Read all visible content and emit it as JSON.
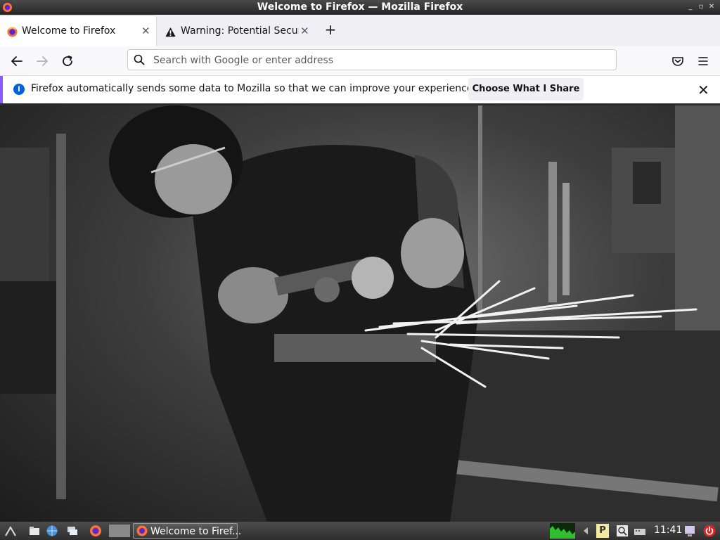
{
  "window": {
    "title": "Welcome to Firefox — Mozilla Firefox"
  },
  "tabs": [
    {
      "label": "Welcome to Firefox",
      "active": true,
      "icon": "firefox-icon"
    },
    {
      "label": "Warning: Potential Security Risk Ahead",
      "active": false,
      "icon": "warning-icon"
    }
  ],
  "new_tab": {
    "icon": "plus-icon"
  },
  "navbar": {
    "url_placeholder": "Search with Google or enter address",
    "url_value": ""
  },
  "notification": {
    "message": "Firefox automatically sends some data to Mozilla so that we can improve your experience.",
    "button_label": "Choose What I Share"
  },
  "taskbar": {
    "window_button_label": "Welcome to Firef...",
    "clock": "11:41"
  },
  "colors": {
    "accent": "#9059ff",
    "info_blue": "#0060df"
  }
}
